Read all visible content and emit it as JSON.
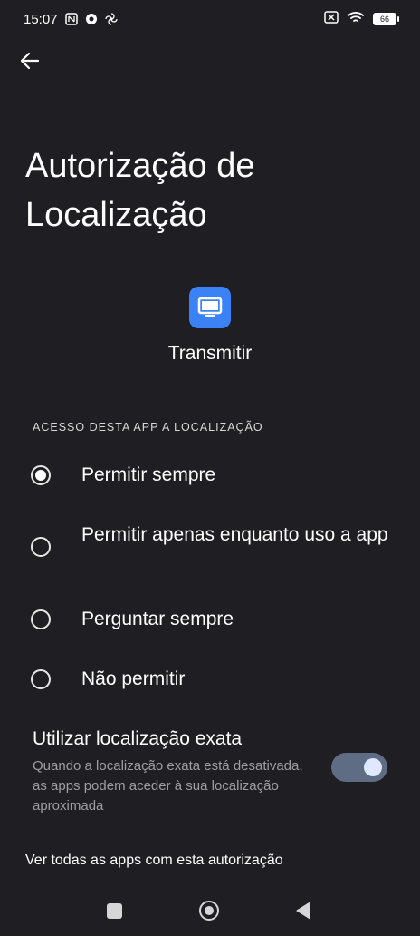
{
  "status_bar": {
    "time": "15:07",
    "battery_level": "66",
    "icons_left": [
      "nfc-icon",
      "chrome-icon",
      "fan-icon"
    ],
    "icons_right": [
      "no-sim-icon",
      "wifi-icon",
      "battery-icon"
    ]
  },
  "header": {
    "title": "Autorização de Localização"
  },
  "app": {
    "name": "Transmitir",
    "icon": "tv-icon",
    "icon_color": "#3b82f6"
  },
  "section": {
    "header": "ACESSO DESTA APP A LOCALIZAÇÃO"
  },
  "options": [
    {
      "label": "Permitir sempre",
      "checked": true
    },
    {
      "label": "Permitir apenas enquanto uso a app",
      "checked": false
    },
    {
      "label": "Perguntar sempre",
      "checked": false
    },
    {
      "label": "Não permitir",
      "checked": false
    }
  ],
  "exact_location": {
    "title": "Utilizar localização exata",
    "description": "Quando a localização exata está desativada, as apps podem aceder à sua localização aproximada",
    "enabled": true
  },
  "footer": {
    "see_all": "Ver todas as apps com esta autorização"
  }
}
